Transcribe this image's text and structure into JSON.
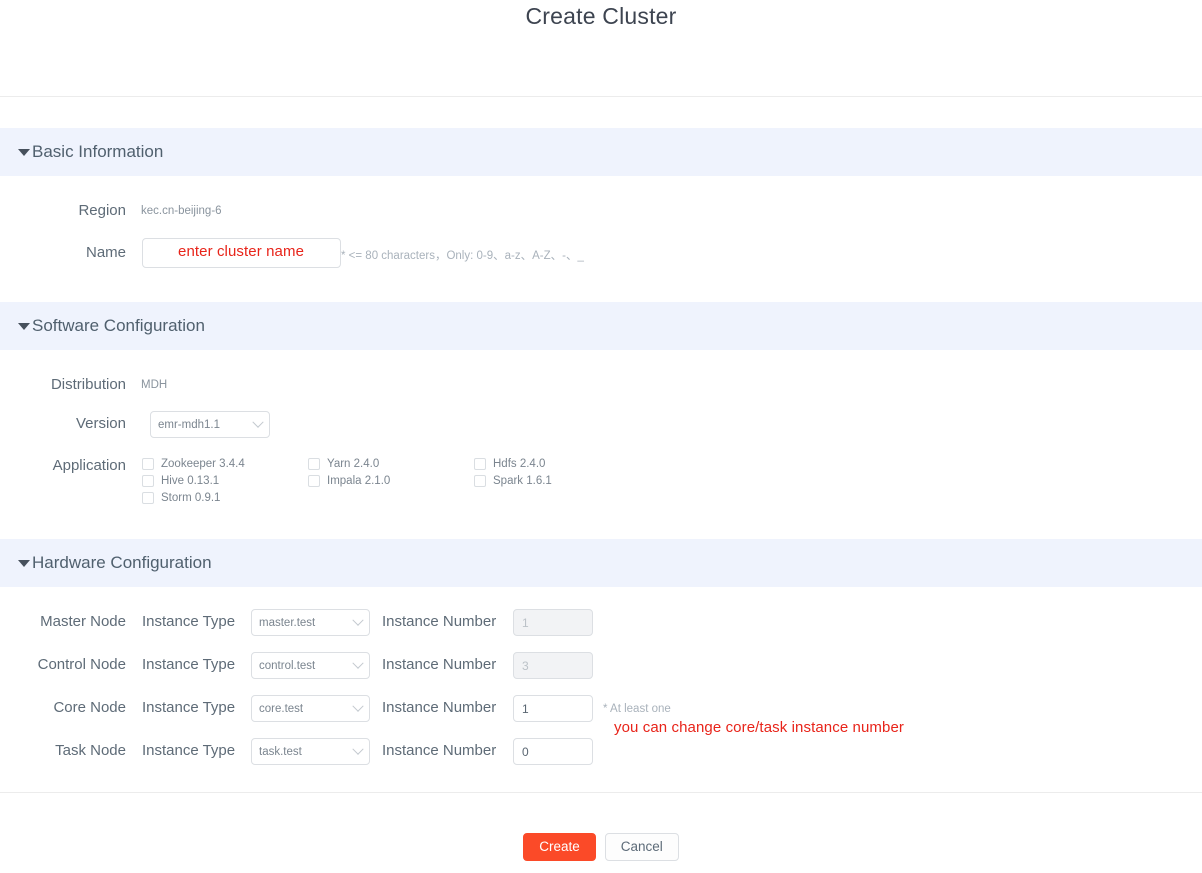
{
  "page": {
    "title": "Create Cluster"
  },
  "sections": {
    "basic": {
      "title": "Basic Information",
      "region_label": "Region",
      "region_value": "kec.cn-beijing-6",
      "name_label": "Name",
      "name_value": "",
      "name_placeholder": "",
      "name_annotation": "enter cluster name",
      "name_hint": "* <= 80 characters，Only: 0-9、a-z、A-Z、-、_"
    },
    "software": {
      "title": "Software Configuration",
      "distribution_label": "Distribution",
      "distribution_value": "MDH",
      "version_label": "Version",
      "version_selected": "emr-mdh1.1",
      "application_label": "Application",
      "applications": [
        {
          "label": "Zookeeper 3.4.4",
          "checked": false
        },
        {
          "label": "Yarn 2.4.0",
          "checked": false
        },
        {
          "label": "Hdfs 2.4.0",
          "checked": false
        },
        {
          "label": "Hive 0.13.1",
          "checked": false
        },
        {
          "label": "Impala 2.1.0",
          "checked": false
        },
        {
          "label": "Spark 1.6.1",
          "checked": false
        },
        {
          "label": "Storm 0.9.1",
          "checked": false
        }
      ]
    },
    "hardware": {
      "title": "Hardware Configuration",
      "instance_type_label": "Instance Type",
      "instance_number_label": "Instance Number",
      "core_hint": "* At least one",
      "core_annotation": "you can change core/task instance number",
      "nodes": [
        {
          "name": "Master Node",
          "instance_type": "master.test",
          "instance_number": "1",
          "disabled": true
        },
        {
          "name": "Control Node",
          "instance_type": "control.test",
          "instance_number": "3",
          "disabled": true
        },
        {
          "name": "Core Node",
          "instance_type": "core.test",
          "instance_number": "1",
          "disabled": false
        },
        {
          "name": "Task Node",
          "instance_type": "task.test",
          "instance_number": "0",
          "disabled": false
        }
      ]
    }
  },
  "footer": {
    "create_label": "Create",
    "cancel_label": "Cancel"
  },
  "colors": {
    "accent": "#fb4a28",
    "section_header_bg": "#eff3fd",
    "annotation": "#e8241a"
  }
}
